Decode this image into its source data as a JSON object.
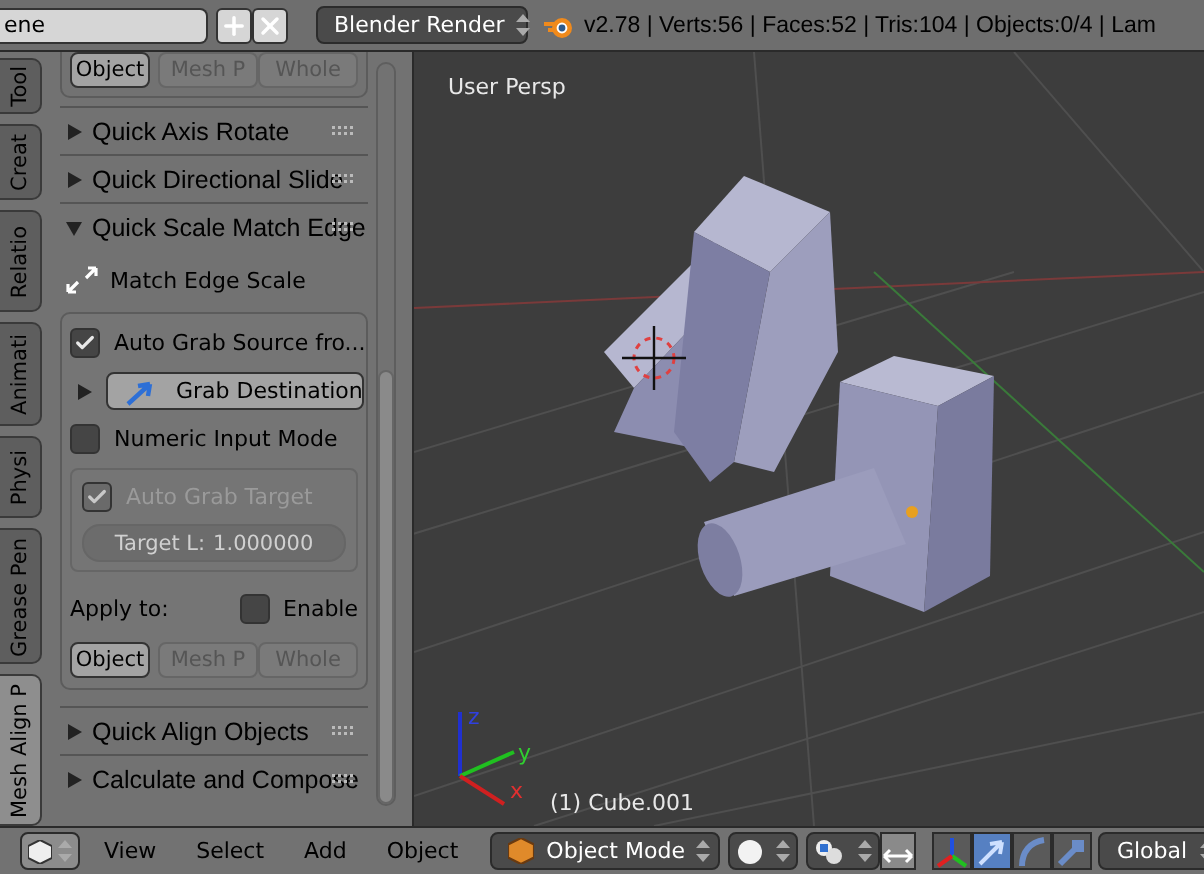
{
  "top_bar": {
    "scene_field": {
      "value": "ene"
    },
    "render_engine": {
      "value": "Blender Render"
    },
    "stats": "v2.78 | Verts:56 | Faces:52 | Tris:104 | Objects:0/4 | Lam"
  },
  "tabs": [
    {
      "label": "Tool",
      "selected": false
    },
    {
      "label": "Creat",
      "selected": false
    },
    {
      "label": "Relatio",
      "selected": false
    },
    {
      "label": "Animati",
      "selected": false
    },
    {
      "label": "Physi",
      "selected": false
    },
    {
      "label": "Grease Pen",
      "selected": false
    },
    {
      "label": "Mesh Align P",
      "selected": true
    }
  ],
  "panel": {
    "top_targets": [
      {
        "label": "Object",
        "disabled": false
      },
      {
        "label": "Mesh P",
        "disabled": true
      },
      {
        "label": "Whole",
        "disabled": true
      }
    ],
    "sections": [
      {
        "title": "Quick Axis Rotate",
        "expanded": false
      },
      {
        "title": "Quick Directional Slide",
        "expanded": false
      },
      {
        "title": "Quick Scale Match Edge",
        "expanded": true,
        "body": {
          "action_button": "Match Edge Scale",
          "options": [
            {
              "kind": "checkbox",
              "label": "Auto Grab Source fro...",
              "checked": true,
              "disabled": false
            },
            {
              "kind": "button",
              "label": "Grab Destination",
              "expanded": false
            },
            {
              "kind": "checkbox",
              "label": "Numeric Input Mode",
              "checked": false,
              "disabled": false
            },
            {
              "kind": "group",
              "disabled": true,
              "items": [
                {
                  "kind": "checkbox",
                  "label": "Auto Grab Target",
                  "checked": true
                },
                {
                  "kind": "number",
                  "label": "Target L:",
                  "value": "1.000000"
                }
              ]
            }
          ],
          "apply_to": {
            "label": "Apply to:",
            "enable": {
              "label": "Enable",
              "checked": false
            }
          },
          "targets": [
            {
              "label": "Object",
              "disabled": false
            },
            {
              "label": "Mesh P",
              "disabled": true
            },
            {
              "label": "Whole",
              "disabled": true
            }
          ]
        }
      },
      {
        "title": "Quick Align Objects",
        "expanded": false
      },
      {
        "title": "Calculate and Compose",
        "expanded": false
      }
    ]
  },
  "viewport": {
    "view_label": "User Persp",
    "object_label": "(1) Cube.001",
    "axes": {
      "x": "x",
      "y": "y",
      "z": "z"
    }
  },
  "bottom_bar": {
    "menus": [
      "View",
      "Select",
      "Add",
      "Object"
    ],
    "mode": "Object Mode",
    "manipulators": [
      {
        "kind": "axes",
        "selected": false
      },
      {
        "kind": "translate",
        "selected": true
      },
      {
        "kind": "rotate",
        "selected": false
      },
      {
        "kind": "scale",
        "selected": false
      }
    ],
    "orientation": "Global"
  }
}
